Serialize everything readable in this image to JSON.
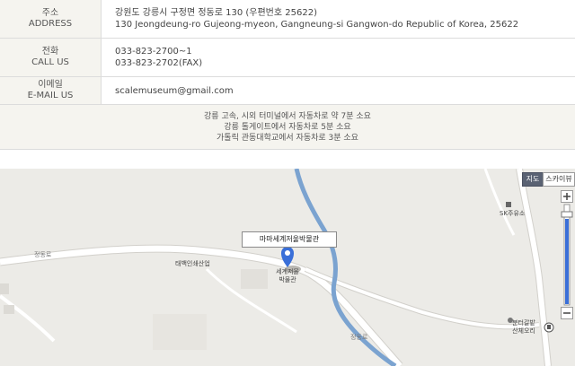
{
  "contact": {
    "address": {
      "label_ko": "주소",
      "label_en": "ADDRESS",
      "line1": "강원도 강릉시 구정면 정동로 130 (우편번호 25622)",
      "line2": "130 Jeongdeung-ro Gujeong-myeon, Gangneung-si Gangwon-do Republic of Korea, 25622"
    },
    "phone": {
      "label_ko": "전화",
      "label_en": "CALL US",
      "tel": "033-823-2700~1",
      "fax": "033-823-2702(FAX)"
    },
    "email": {
      "label_ko": "이메일",
      "label_en": "E-MAIL US",
      "value": "scalemuseum@gmail.com"
    }
  },
  "directions": {
    "line1": "강릉 고속, 시외 터미널에서 자동차로 약 7분 소요",
    "line2": "강릉 톨게이트에서 자동차로 5분 소요",
    "line3": "가톨릭 관동대학교에서 자동차로 3분 소요"
  },
  "map": {
    "type_map": "지도",
    "type_satellite": "스카이뷰",
    "callout": "마마세계저울박물관",
    "marker_label_1": "세계저울",
    "marker_label_2": "박물관",
    "place_company": "태백인쇄산업",
    "place_gas": "SK주유소",
    "place_bus_1": "분터갈밭",
    "place_bus_2": "산체오리",
    "road_left": "정동로",
    "road_river": "정동로",
    "colors": {
      "background": "#ecebe7",
      "road": "#ffffff",
      "river": "#7ba3d0",
      "marker": "#3a6fd8",
      "zoom_bar": "#3a6fd8"
    }
  }
}
